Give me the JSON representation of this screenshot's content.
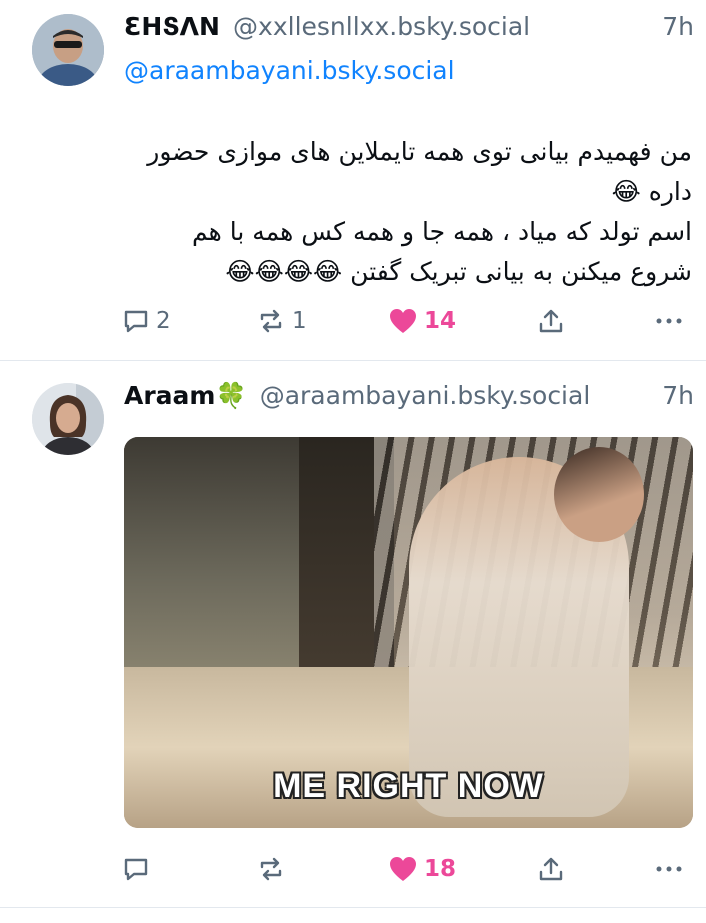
{
  "posts": [
    {
      "author_name": "ƐHՏΛN",
      "handle": "@xxllesnllxx.bsky.social",
      "time": "7h",
      "mention": "@araambayani.bsky.social",
      "text": "من فهمیدم بیانی توی همه تایملاین های موازی حضور داره 😂\nاسم تولد که میاد ، همه جا و همه کس همه با هم شروع میکنن به بیانی تبریک گفتن 😂😂😂😂",
      "replies": "2",
      "reposts": "1",
      "likes": "14",
      "liked": true
    },
    {
      "author_name": "Araam🍀",
      "handle": "@araambayani.bsky.social",
      "time": "7h",
      "media_caption": "ME RIGHT NOW",
      "likes": "18",
      "liked": true
    }
  ],
  "colors": {
    "accent": "#1083fe",
    "like": "#ec4899",
    "muted": "#5a6a7a",
    "divider": "#e3e8ee"
  },
  "icons": [
    "reply-icon",
    "repost-icon",
    "heart-icon",
    "share-icon",
    "more-icon"
  ]
}
